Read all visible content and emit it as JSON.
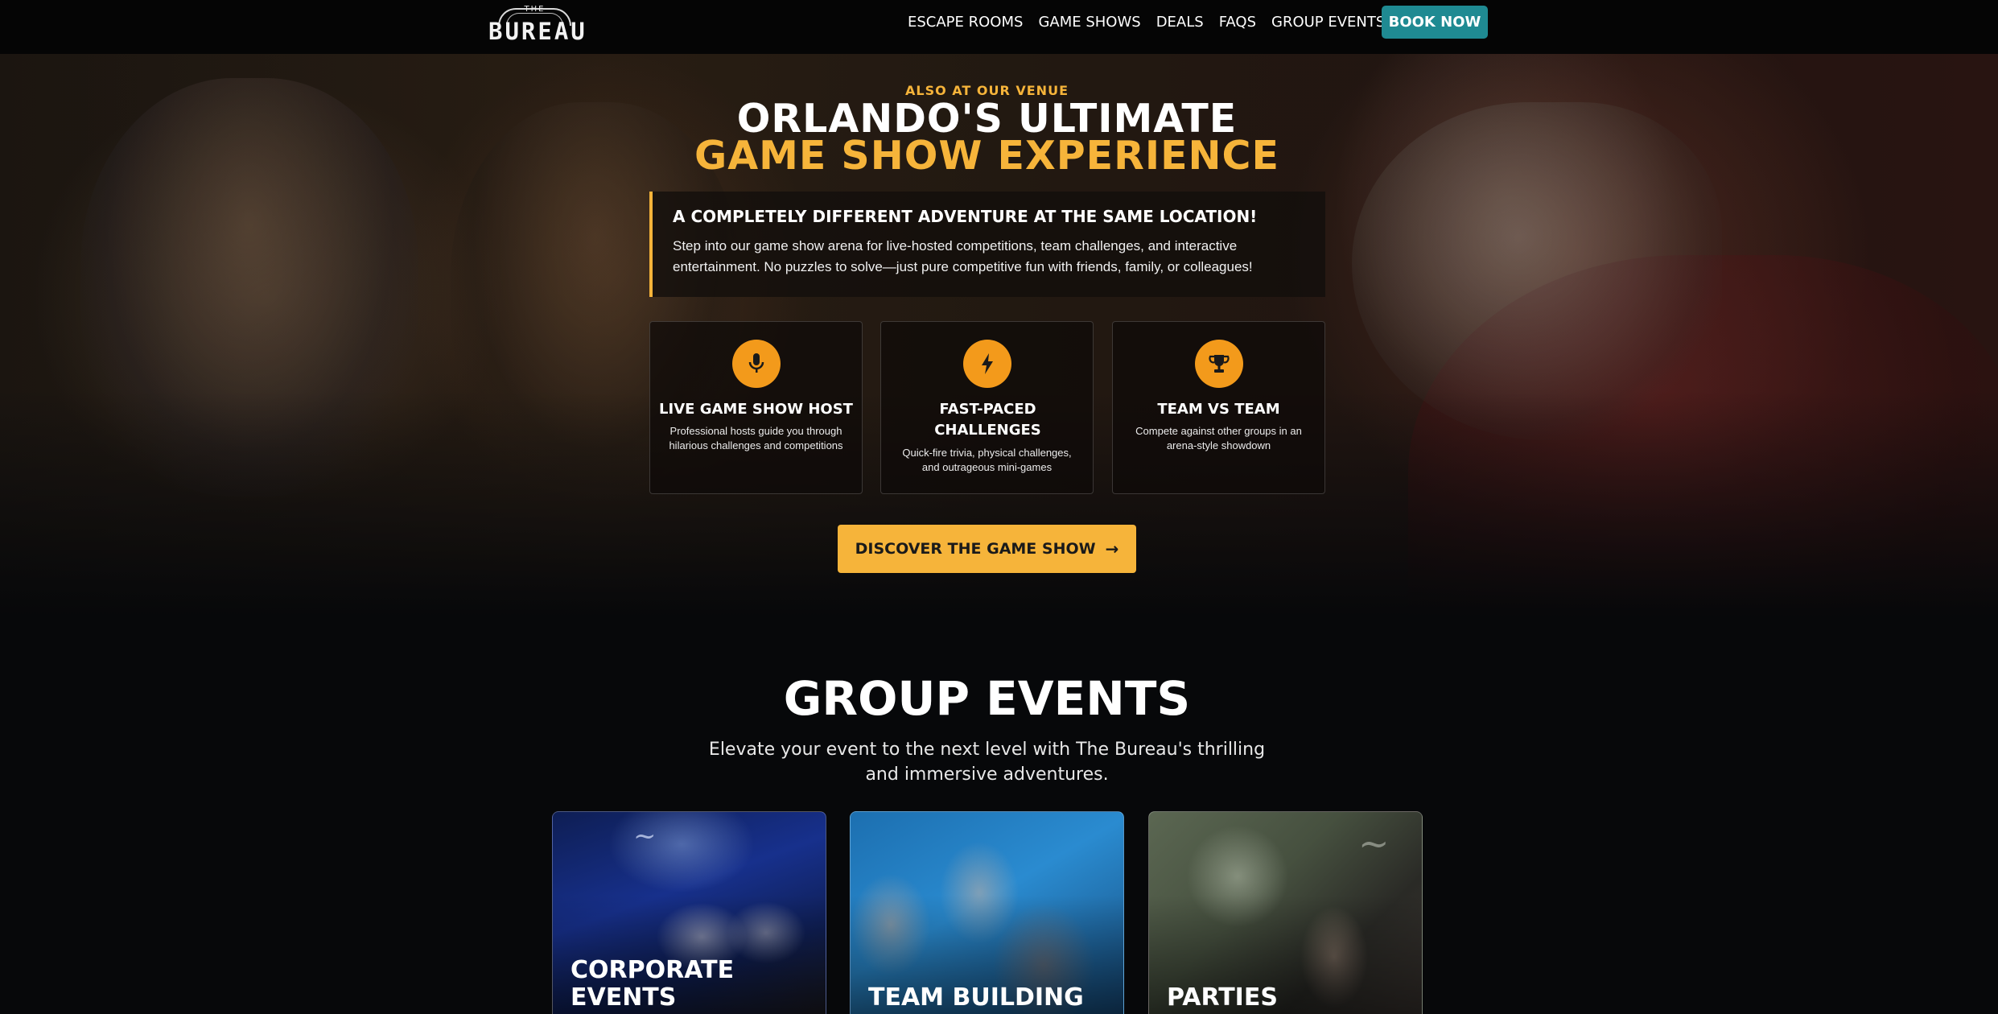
{
  "nav": {
    "logo_top": "THE",
    "logo_word": "BUREAU",
    "links": [
      "ESCAPE ROOMS",
      "GAME SHOWS",
      "DEALS",
      "FAQS",
      "GROUP EVENTS"
    ],
    "book_label": "BOOK NOW",
    "book_color": "#1f8a92"
  },
  "hero": {
    "eyebrow": "ALSO AT OUR VENUE",
    "title_line1": "ORLANDO'S ULTIMATE",
    "title_line2": "GAME SHOW EXPERIENCE",
    "accent_color": "#f6b43a",
    "intro": {
      "heading": "A COMPLETELY DIFFERENT ADVENTURE AT THE SAME LOCATION!",
      "body": "Step into our game show arena for live-hosted competitions, team challenges, and interactive entertainment. No puzzles to solve—just pure competitive fun with friends, family, or colleagues!"
    },
    "features": [
      {
        "icon": "microphone-icon",
        "title": "LIVE GAME SHOW HOST",
        "desc": "Professional hosts guide you through hilarious challenges and competitions"
      },
      {
        "icon": "lightning-icon",
        "title": "FAST-PACED CHALLENGES",
        "desc": "Quick-fire trivia, physical challenges, and outrageous mini-games"
      },
      {
        "icon": "trophy-icon",
        "title": "TEAM VS TEAM",
        "desc": "Compete against other groups in an arena-style showdown"
      }
    ],
    "cta_label": "DISCOVER THE GAME SHOW",
    "cta_arrow": "→"
  },
  "group_events": {
    "title": "GROUP EVENTS",
    "subtitle": "Elevate your event to the next level with The Bureau's thrilling and immersive adventures.",
    "cards": [
      {
        "label_line1": "CORPORATE",
        "label_line2": "EVENTS"
      },
      {
        "label_line1": "",
        "label_line2": "TEAM BUILDING"
      },
      {
        "label_line1": "",
        "label_line2": "PARTIES"
      }
    ]
  }
}
